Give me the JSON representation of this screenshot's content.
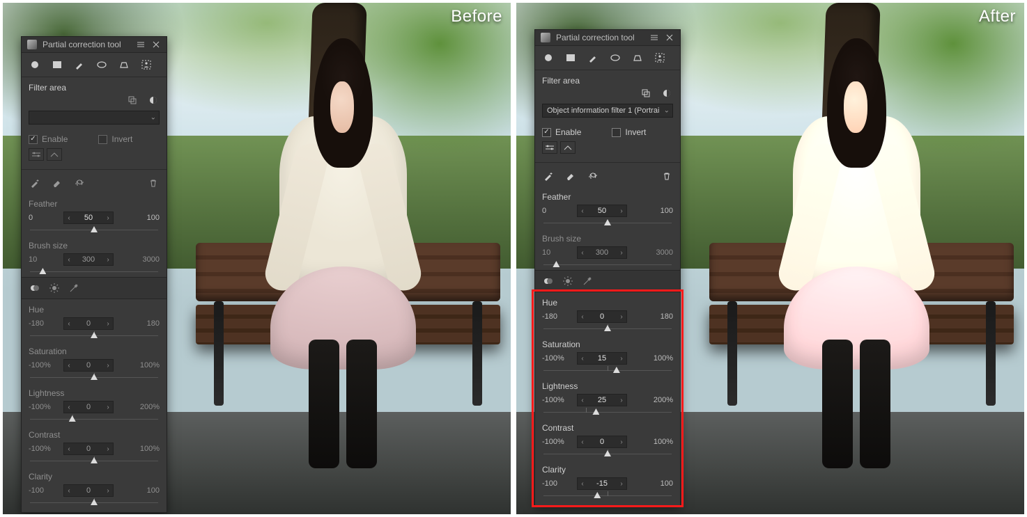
{
  "labels": {
    "before": "Before",
    "after": "After"
  },
  "panel_title": "Partial correction tool",
  "filter_area_label": "Filter area",
  "enable_label": "Enable",
  "invert_label": "Invert",
  "before": {
    "filter_selection": "",
    "enable_checked": true,
    "invert_checked": false,
    "params": {
      "feather": {
        "name": "Feather",
        "min": "0",
        "max": "100",
        "value": "50",
        "pos": 50
      },
      "brush": {
        "name": "Brush size",
        "min": "10",
        "max": "3000",
        "value": "300",
        "pos": 10
      },
      "hue": {
        "name": "Hue",
        "min": "-180",
        "max": "180",
        "value": "0",
        "pos": 50
      },
      "saturation": {
        "name": "Saturation",
        "min": "-100%",
        "max": "100%",
        "value": "0",
        "pos": 50
      },
      "lightness": {
        "name": "Lightness",
        "min": "-100%",
        "max": "200%",
        "value": "0",
        "pos": 33
      },
      "contrast": {
        "name": "Contrast",
        "min": "-100%",
        "max": "100%",
        "value": "0",
        "pos": 50
      },
      "clarity": {
        "name": "Clarity",
        "min": "-100",
        "max": "100",
        "value": "0",
        "pos": 50
      }
    }
  },
  "after": {
    "filter_selection": "Object information filter 1 (Portrai",
    "enable_checked": true,
    "invert_checked": false,
    "params": {
      "feather": {
        "name": "Feather",
        "min": "0",
        "max": "100",
        "value": "50",
        "pos": 50
      },
      "brush": {
        "name": "Brush size",
        "min": "10",
        "max": "3000",
        "value": "300",
        "pos": 10
      },
      "hue": {
        "name": "Hue",
        "min": "-180",
        "max": "180",
        "value": "0",
        "pos": 50
      },
      "saturation": {
        "name": "Saturation",
        "min": "-100%",
        "max": "100%",
        "value": "15",
        "pos": 57
      },
      "lightness": {
        "name": "Lightness",
        "min": "-100%",
        "max": "200%",
        "value": "25",
        "pos": 41
      },
      "contrast": {
        "name": "Contrast",
        "min": "-100%",
        "max": "100%",
        "value": "0",
        "pos": 50
      },
      "clarity": {
        "name": "Clarity",
        "min": "-100",
        "max": "100",
        "value": "-15",
        "pos": 42
      }
    }
  }
}
